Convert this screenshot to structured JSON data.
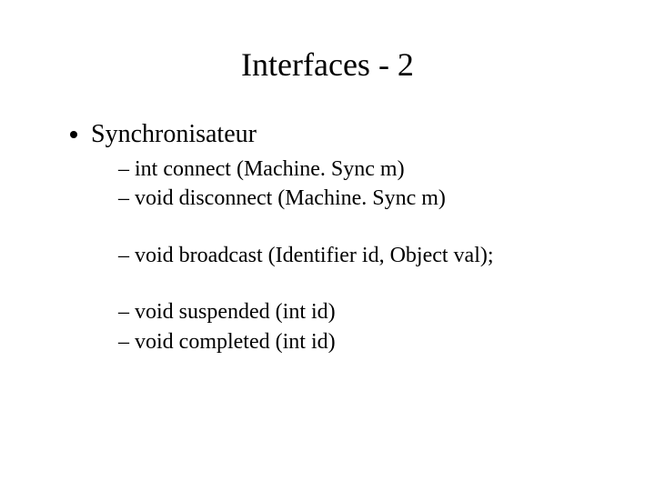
{
  "title": "Interfaces - 2",
  "bullets": {
    "l1": "Synchronisateur",
    "sub": [
      "int connect (Machine. Sync m)",
      "void disconnect (Machine. Sync m)",
      "void broadcast (Identifier id, Object val);",
      "void suspended (int id)",
      "void completed (int id)"
    ]
  }
}
